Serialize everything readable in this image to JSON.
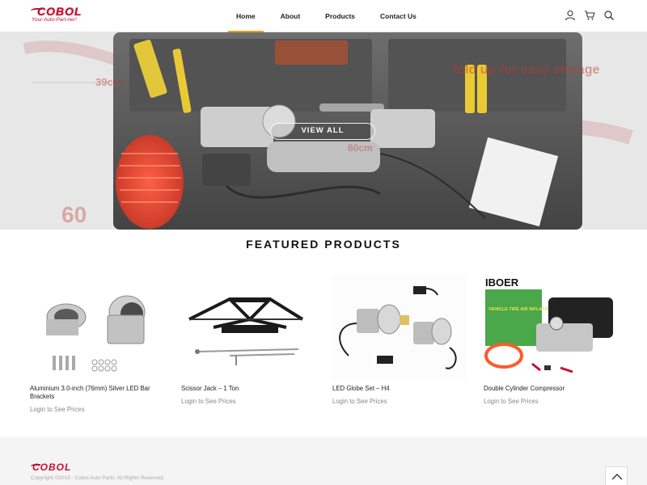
{
  "header": {
    "logo_text": "COBOL",
    "logo_tagline": "Your Auto-Part-ner!",
    "nav": [
      {
        "label": "Home",
        "active": true
      },
      {
        "label": "About",
        "active": false
      },
      {
        "label": "Products",
        "active": false
      },
      {
        "label": "Contact Us",
        "active": false
      }
    ],
    "icons": [
      "user-icon",
      "cart-icon",
      "search-icon"
    ],
    "accent_color": "#e8a317",
    "brand_color": "#c8102e"
  },
  "hero": {
    "button_label": "VIEW ALL",
    "overlay_texts": {
      "dim_39": "39cm",
      "fold": "fold up for easy storage",
      "dim_60a": "60cm",
      "dim_60b": "60"
    }
  },
  "featured": {
    "title": "FEATURED PRODUCTS",
    "products": [
      {
        "name": "Aluminium 3.0-inch (76mm) Silver LED Bar Brackets",
        "price": "Login to See Prices"
      },
      {
        "name": "Scissor Jack – 1 Ton",
        "price": "Login to See Prices"
      },
      {
        "name": "LED Globe Set – H4",
        "price": "Login to See Prices"
      },
      {
        "name": "Double Cylinder Compressor",
        "price": "Login to See Prices",
        "brand_text": "IBOER",
        "box_text": "VEHICLE TIRE AIR INFLATING PUMP"
      }
    ]
  },
  "footer": {
    "logo_text": "COBOL",
    "copyright": "Copyright ©2019 - Cobol Auto Parts. All Rights Reserved."
  }
}
